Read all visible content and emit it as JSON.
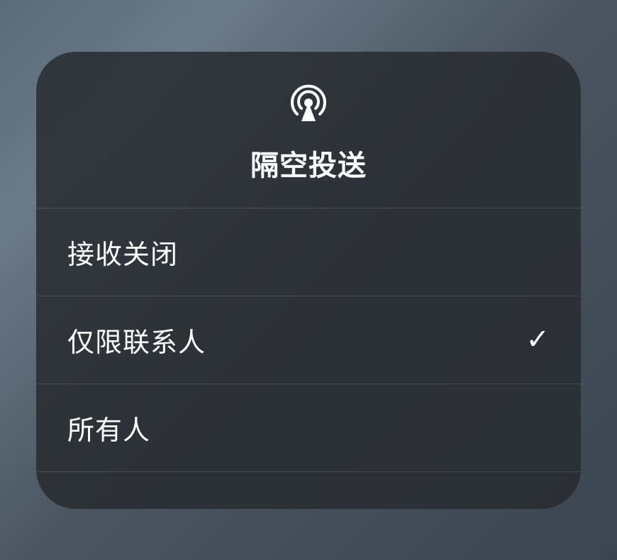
{
  "airdrop": {
    "title": "隔空投送",
    "options": [
      {
        "label": "接收关闭",
        "selected": false
      },
      {
        "label": "仅限联系人",
        "selected": true
      },
      {
        "label": "所有人",
        "selected": false
      }
    ]
  }
}
